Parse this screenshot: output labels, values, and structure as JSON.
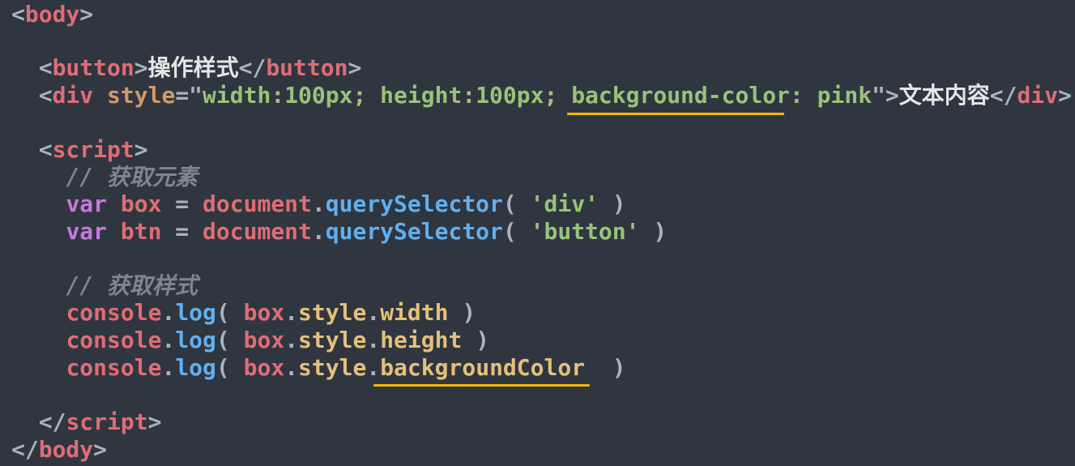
{
  "editor": {
    "lines": {
      "body_open": "body",
      "button_tag": "button",
      "button_text": "操作样式",
      "div_tag": "div",
      "div_attr": "style",
      "div_style_part1": "width:100px; height:100px; ",
      "div_style_part2": "background-color",
      "div_style_part3": ": pink",
      "div_text": "文本内容",
      "script_tag": "script",
      "comment1": "// 获取元素",
      "var_kw": "var",
      "box_var": "box",
      "btn_var": "btn",
      "document": "document",
      "querySelector": "querySelector",
      "sel_div": "'div'",
      "sel_button": "'button'",
      "comment2": "// 获取样式",
      "console": "console",
      "log": "log",
      "style": "style",
      "width": "width",
      "height": "height",
      "backgroundColor": "backgroundColor"
    },
    "highlight_color": "#f5b800"
  }
}
